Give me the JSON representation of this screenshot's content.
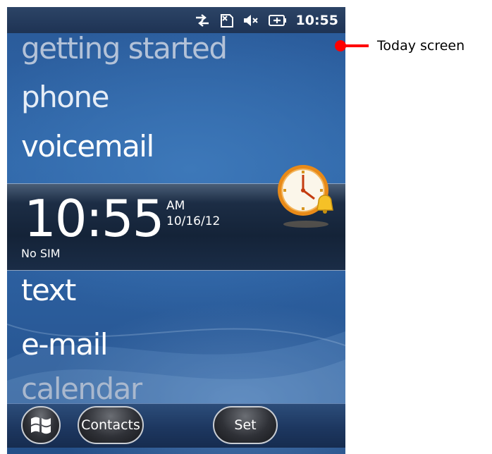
{
  "status_bar": {
    "icons": [
      "data-connection-arrows-icon",
      "no-sim-card-icon",
      "speaker-muted-icon",
      "battery-charging-icon"
    ],
    "time": "10:55"
  },
  "today_screen": {
    "menu_items": [
      "getting started",
      "phone",
      "voicemail",
      "text",
      "e-mail",
      "calendar"
    ],
    "clock": {
      "time": "10:55",
      "ampm": "AM",
      "date": "10/16/12",
      "sim_status": "No SIM",
      "alarm_icon": "alarm-clock-icon"
    }
  },
  "taskbar": {
    "start_icon": "windows-logo-icon",
    "left_softkey": "Contacts",
    "right_softkey": "Set"
  },
  "callout": {
    "label": "Today screen",
    "color": "#ff0000"
  }
}
